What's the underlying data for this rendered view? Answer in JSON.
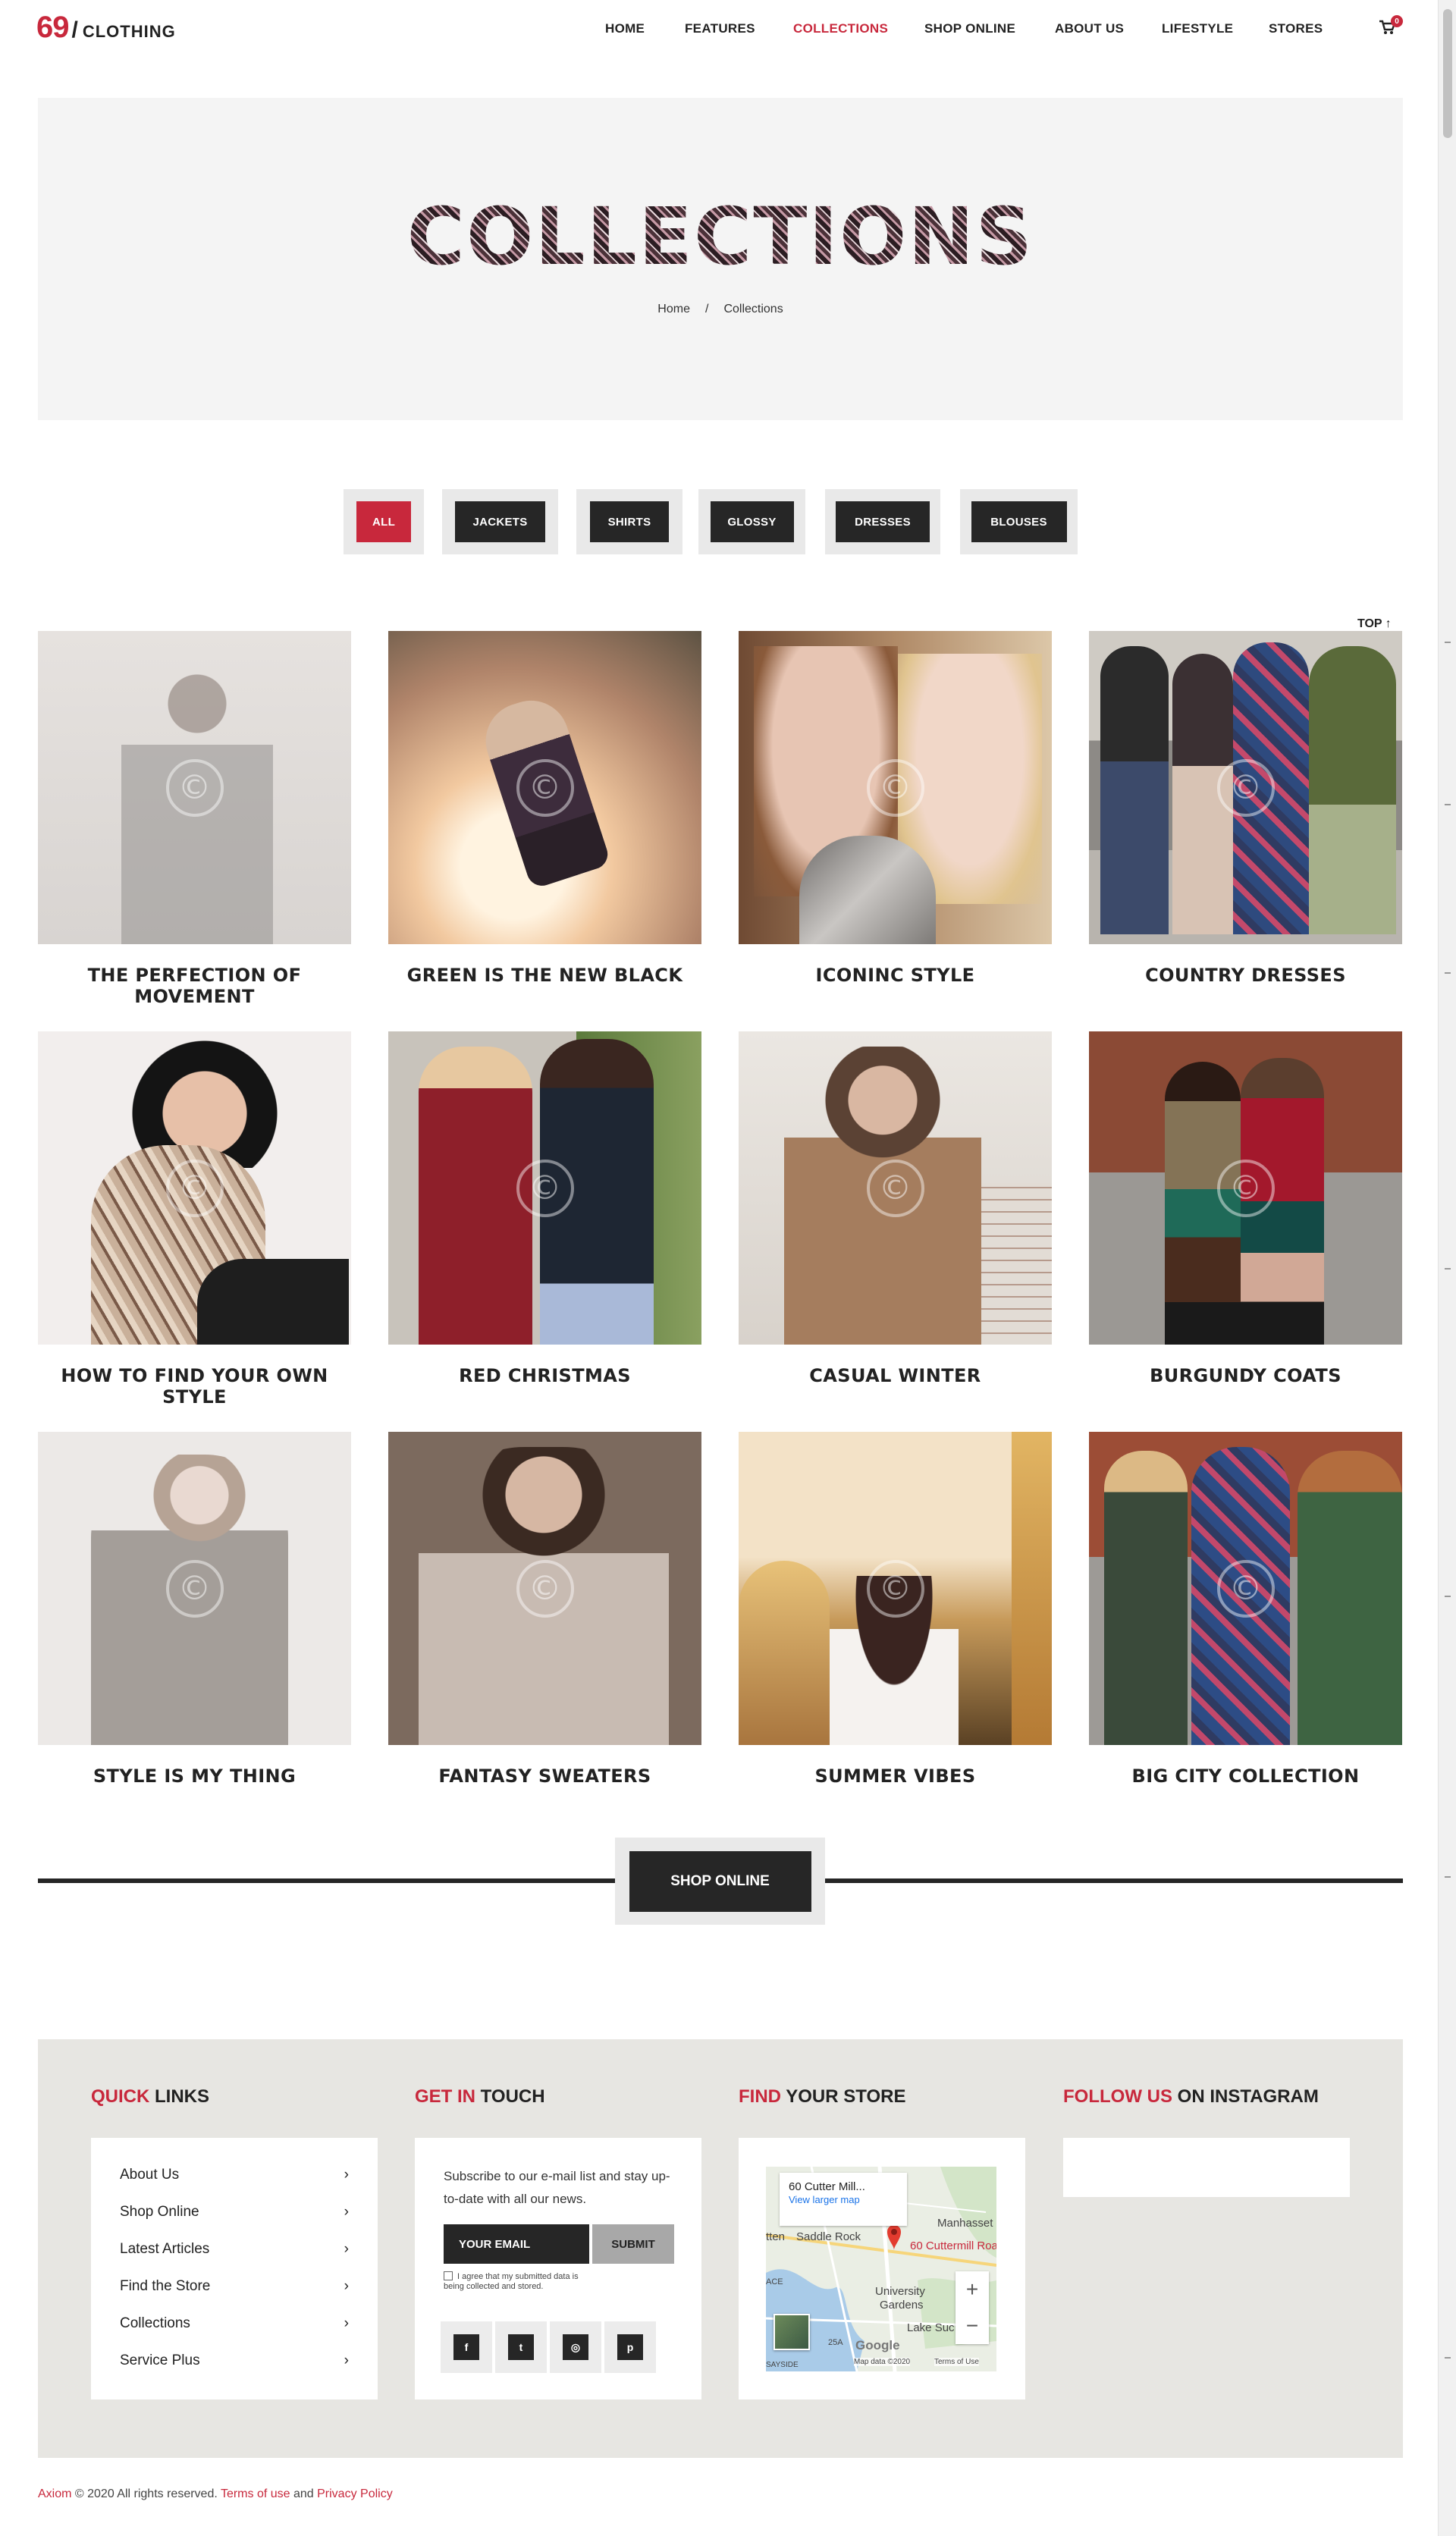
{
  "logo": {
    "number": "69",
    "slash": "/",
    "word": "CLOTHING"
  },
  "nav": [
    {
      "label": "HOME",
      "active": false
    },
    {
      "label": "FEATURES",
      "active": false
    },
    {
      "label": "COLLECTIONS",
      "active": true
    },
    {
      "label": "SHOP ONLINE",
      "active": false
    },
    {
      "label": "ABOUT US",
      "active": false
    },
    {
      "label": "LIFESTYLE",
      "active": false
    },
    {
      "label": "STORES",
      "active": false
    }
  ],
  "cart": {
    "icon": "cart-icon",
    "count": "0"
  },
  "hero": {
    "title": "COLLECTIONS",
    "breadcrumb": {
      "home": "Home",
      "sep": "/",
      "current": "Collections"
    }
  },
  "filters": [
    "ALL",
    "JACKETS",
    "SHIRTS",
    "GLOSSY",
    "DRESSES",
    "BLOUSES"
  ],
  "filter_active": "ALL",
  "top_link": "TOP ↑",
  "collections": [
    {
      "title": "THE PERFECTION OF MOVEMENT"
    },
    {
      "title": "GREEN IS THE NEW BLACK"
    },
    {
      "title": "ICONINC STYLE"
    },
    {
      "title": "COUNTRY DRESSES"
    },
    {
      "title": "HOW TO FIND YOUR OWN STYLE"
    },
    {
      "title": "RED CHRISTMAS"
    },
    {
      "title": "CASUAL WINTER"
    },
    {
      "title": "BURGUNDY COATS"
    },
    {
      "title": "STYLE IS MY THING"
    },
    {
      "title": "FANTASY SWEATERS"
    },
    {
      "title": "SUMMER VIBES"
    },
    {
      "title": "BIG CITY COLLECTION"
    }
  ],
  "shop_online": "SHOP ONLINE",
  "footer": {
    "quick": {
      "accent": "QUICK",
      "rest": " LINKS",
      "links": [
        "About Us",
        "Shop Online",
        "Latest Articles",
        "Find the Store",
        "Collections",
        "Service Plus"
      ],
      "chevron": "›"
    },
    "touch": {
      "accent": "GET IN",
      "rest": " TOUCH",
      "text": "Subscribe to our e-mail list and stay up-to-date with all our news.",
      "email_placeholder": "YOUR EMAIL",
      "submit": "SUBMIT",
      "agree": "I agree that my submitted data is being collected and stored.",
      "social": [
        {
          "icon": "facebook-icon",
          "glyph": "f"
        },
        {
          "icon": "twitter-icon",
          "glyph": "t"
        },
        {
          "icon": "instagram-icon",
          "glyph": "◎"
        },
        {
          "icon": "pinterest-icon",
          "glyph": "p"
        }
      ]
    },
    "store": {
      "accent": "FIND",
      "rest": " YOUR STORE",
      "map_name": "60 Cutter Mill...",
      "map_link": "View larger map",
      "map_pin_label": "60 Cuttermill Roa",
      "labels": [
        "Manhasset",
        "Saddle Rock",
        "tten",
        "University",
        "Gardens",
        "Lake Suc",
        "25A",
        "SAYSIDE",
        "ACE"
      ],
      "google": "Google",
      "map_data": "Map data ©2020",
      "terms": "Terms of Use",
      "zoom_in": "+",
      "zoom_out": "−"
    },
    "instagram": {
      "accent": "FOLLOW US",
      "rest": " ON INSTAGRAM"
    }
  },
  "copyright": {
    "brand": "Axiom",
    "text": " © 2020 All rights reserved. ",
    "terms": "Terms of use",
    "and": " and ",
    "privacy": "Privacy Policy"
  },
  "colors": {
    "accent": "#c8283c",
    "dark": "#262626",
    "footer_bg": "#e7e6e2"
  }
}
